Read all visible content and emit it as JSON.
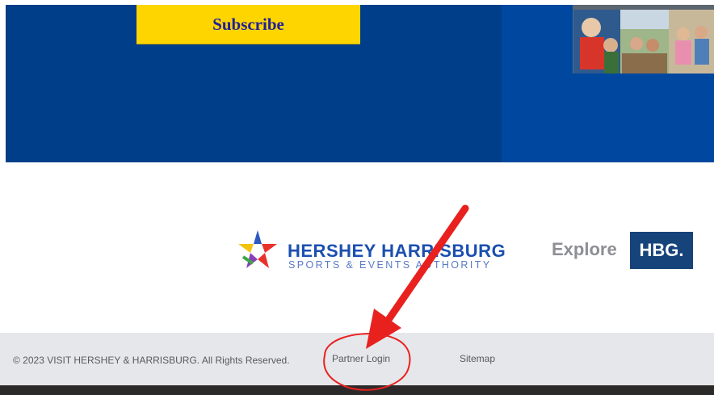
{
  "newsletter": {
    "subscribe_label": "Subscribe"
  },
  "partners": {
    "hhsea_name": "HERSHEY HARRISBURG",
    "hhsea_tagline": "SPORTS & EVENTS AUTHORITY",
    "explore_word": "Explore",
    "explore_badge": "HBG."
  },
  "footer": {
    "copyright": "© 2023 VISIT HERSHEY & HARRISBURG. All Rights Reserved.",
    "partner_login": "Partner Login",
    "sitemap": "Sitemap"
  },
  "colors": {
    "hero_blue": "#003e8a",
    "subscribe_yellow": "#ffd500",
    "annotation_red": "#e8211f",
    "hbg_navy": "#16437a"
  },
  "annotation": {
    "type": "red-arrow-and-circle",
    "highlights": "partner-login-link"
  }
}
